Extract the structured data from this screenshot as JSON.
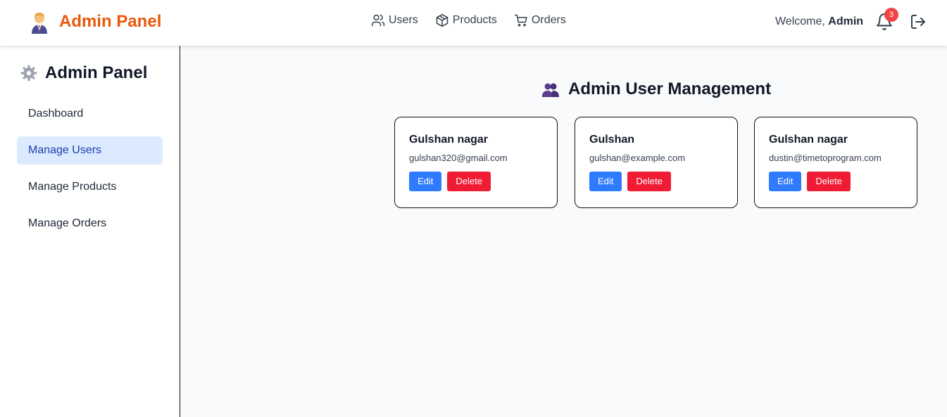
{
  "header": {
    "brand_title": "Admin Panel",
    "nav": [
      {
        "label": "Users",
        "icon": "users-icon"
      },
      {
        "label": "Products",
        "icon": "box-icon"
      },
      {
        "label": "Orders",
        "icon": "cart-icon"
      }
    ],
    "welcome_prefix": "Welcome,",
    "welcome_user": "Admin",
    "notification_count": "3"
  },
  "sidebar": {
    "title": "Admin Panel",
    "items": [
      {
        "label": "Dashboard",
        "active": false
      },
      {
        "label": "Manage Users",
        "active": true
      },
      {
        "label": "Manage Products",
        "active": false
      },
      {
        "label": "Manage Orders",
        "active": false
      }
    ]
  },
  "main": {
    "title": "Admin User Management",
    "users": [
      {
        "name": "Gulshan nagar",
        "email": "gulshan320@gmail.com",
        "edit_label": "Edit",
        "delete_label": "Delete"
      },
      {
        "name": "Gulshan",
        "email": "gulshan@example.com",
        "edit_label": "Edit",
        "delete_label": "Delete"
      },
      {
        "name": "Gulshan nagar",
        "email": "dustin@timetoprogram.com",
        "edit_label": "Edit",
        "delete_label": "Delete"
      }
    ]
  },
  "colors": {
    "brand": "#ea580c",
    "active_bg": "#dbeafe",
    "active_text": "#1e40af",
    "edit": "#2f7bff",
    "delete": "#f01c34",
    "badge": "#ef4444"
  }
}
